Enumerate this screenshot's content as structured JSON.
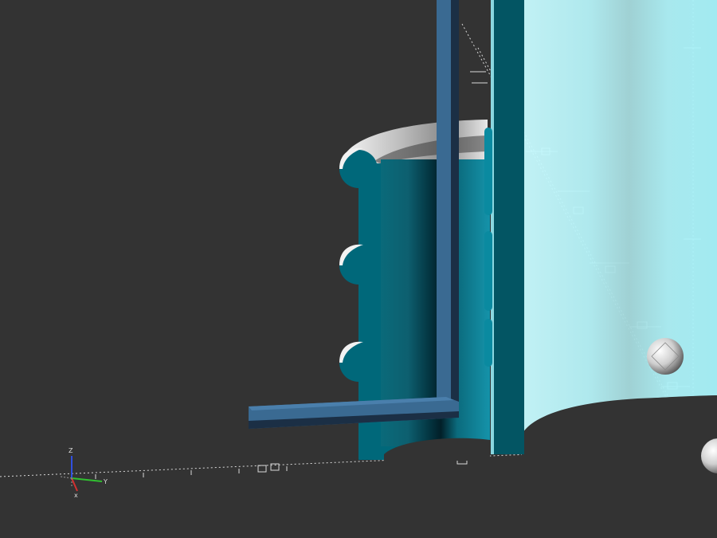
{
  "viewport": {
    "name": "3D preview",
    "background": "#333333"
  },
  "colors": {
    "cylinder_face": "#00687a",
    "cylinder_edge": "#0a8aa0",
    "cylinder_inner_dark": "#042f3a",
    "rod_front": "#3a6a92",
    "rod_top": "#4a7fac",
    "rod_dark": "#1b2f45",
    "slab_dark": "#035563",
    "transparent_surface": "#a8f4fb",
    "grid_line": "#d8d8d8",
    "sphere_light": "#f2f2f2",
    "sphere_dark": "#555555"
  },
  "axes_gizmo": {
    "z_label": "Z",
    "y_label": "Y",
    "x_color": "#d33030",
    "y_color": "#30c030",
    "z_color": "#3050e0"
  }
}
